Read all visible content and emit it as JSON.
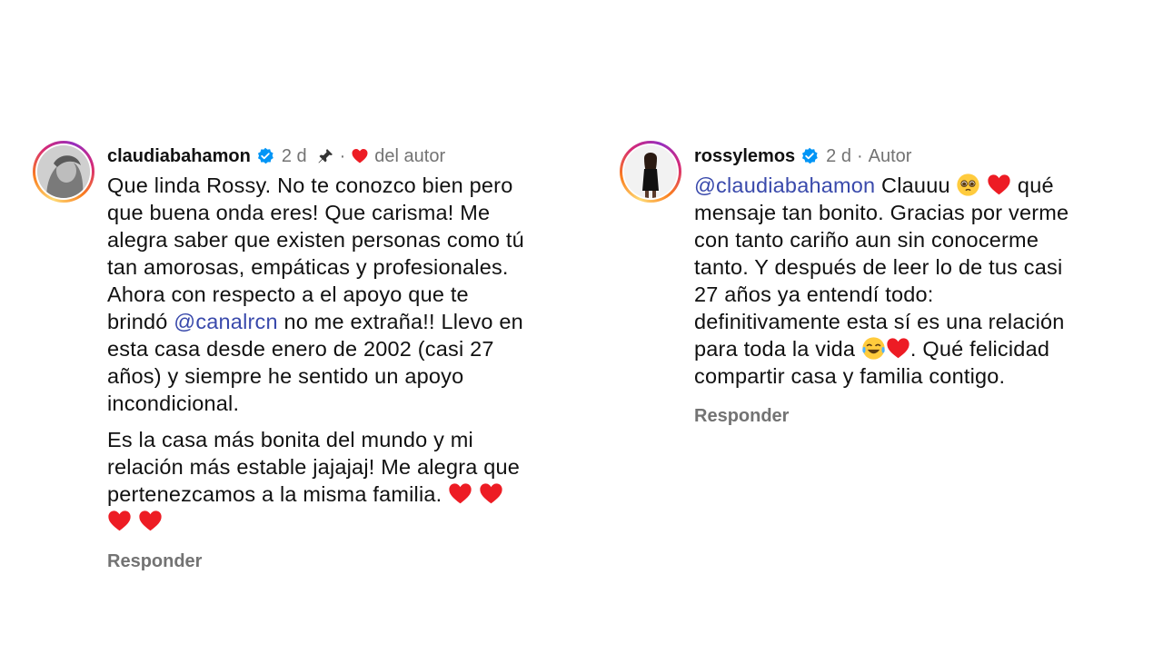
{
  "comments": [
    {
      "username": "claudiabahamon",
      "time": "2 d",
      "liked_label": "del autor",
      "paragraph1": {
        "line1": "Que linda Rossy. No te conozco bien pero",
        "line2": "que buena onda eres! Que carisma! Me",
        "line3": "alegra saber que existen personas como tú",
        "line4": "tan amorosas, empáticas y profesionales.",
        "line5": "Ahora con respecto a el apoyo que te",
        "line6_pre": "brindó ",
        "mention": "@canalrcn",
        "line6_post": " no me extraña!! Llevo en",
        "line7": "esta casa desde enero de 2002 (casi 27",
        "line8": "años) y siempre he sentido un apoyo",
        "line9": "incondicional."
      },
      "paragraph2": {
        "line1": "Es la casa más bonita del mundo y mi",
        "line2": "relación más estable jajajaj! Me alegra que",
        "line3": "pertenezcamos a la misma familia."
      },
      "reply_label": "Responder"
    },
    {
      "username": "rossylemos",
      "time": "2 d",
      "author_label": "Autor",
      "mention": "@claudiabahamon",
      "line1_post": " Clauuu ",
      "line1_end": " qué",
      "line2": "mensaje tan bonito. Gracias por verme",
      "line3": "con tanto cariño aun sin conocerme",
      "line4": "tanto. Y después de leer lo de tus casi",
      "line5": "27 años ya entendí todo:",
      "line6": "definitivamente esta sí es una relación",
      "line7_pre": "para toda la vida ",
      "line7_post": ". Qué felicidad",
      "line8": "compartir casa y familia contigo.",
      "reply_label": "Responder"
    }
  ],
  "colors": {
    "mention": "#3949ab",
    "muted": "#737373",
    "verified": "#0095f6",
    "heart": "#ed1c24"
  }
}
